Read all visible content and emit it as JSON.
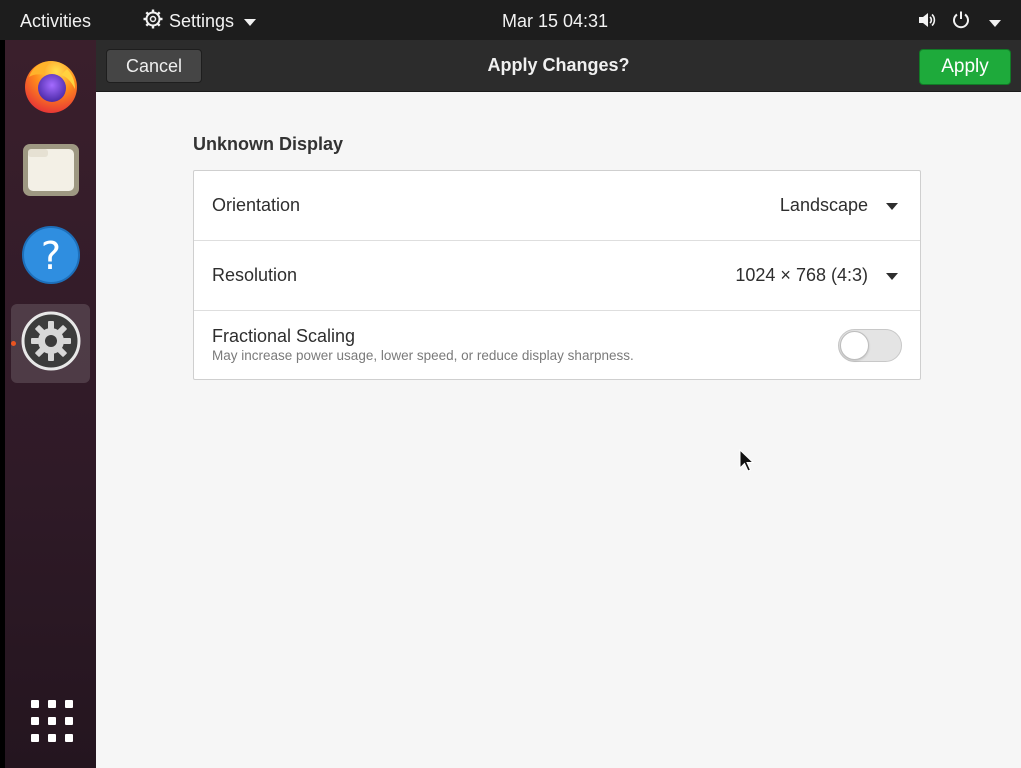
{
  "topbar": {
    "activities": "Activities",
    "app_menu": "Settings",
    "clock": "Mar 15  04:31"
  },
  "dock": {
    "items": [
      {
        "name": "firefox-icon"
      },
      {
        "name": "files-icon"
      },
      {
        "name": "help-icon"
      },
      {
        "name": "settings-icon",
        "active": true
      }
    ]
  },
  "header": {
    "cancel_label": "Cancel",
    "title": "Apply Changes?",
    "apply_label": "Apply"
  },
  "display": {
    "section_title": "Unknown Display",
    "orientation": {
      "label": "Orientation",
      "value": "Landscape"
    },
    "resolution": {
      "label": "Resolution",
      "value": "1024 × 768 (4:3)"
    },
    "fractional_scaling": {
      "label": "Fractional Scaling",
      "description": "May increase power usage, lower speed, or reduce display sharpness.",
      "enabled": false
    }
  },
  "colors": {
    "apply_green": "#1eaa3b",
    "dock_bg": "#2f1a27",
    "active_indicator": "#e95420"
  }
}
